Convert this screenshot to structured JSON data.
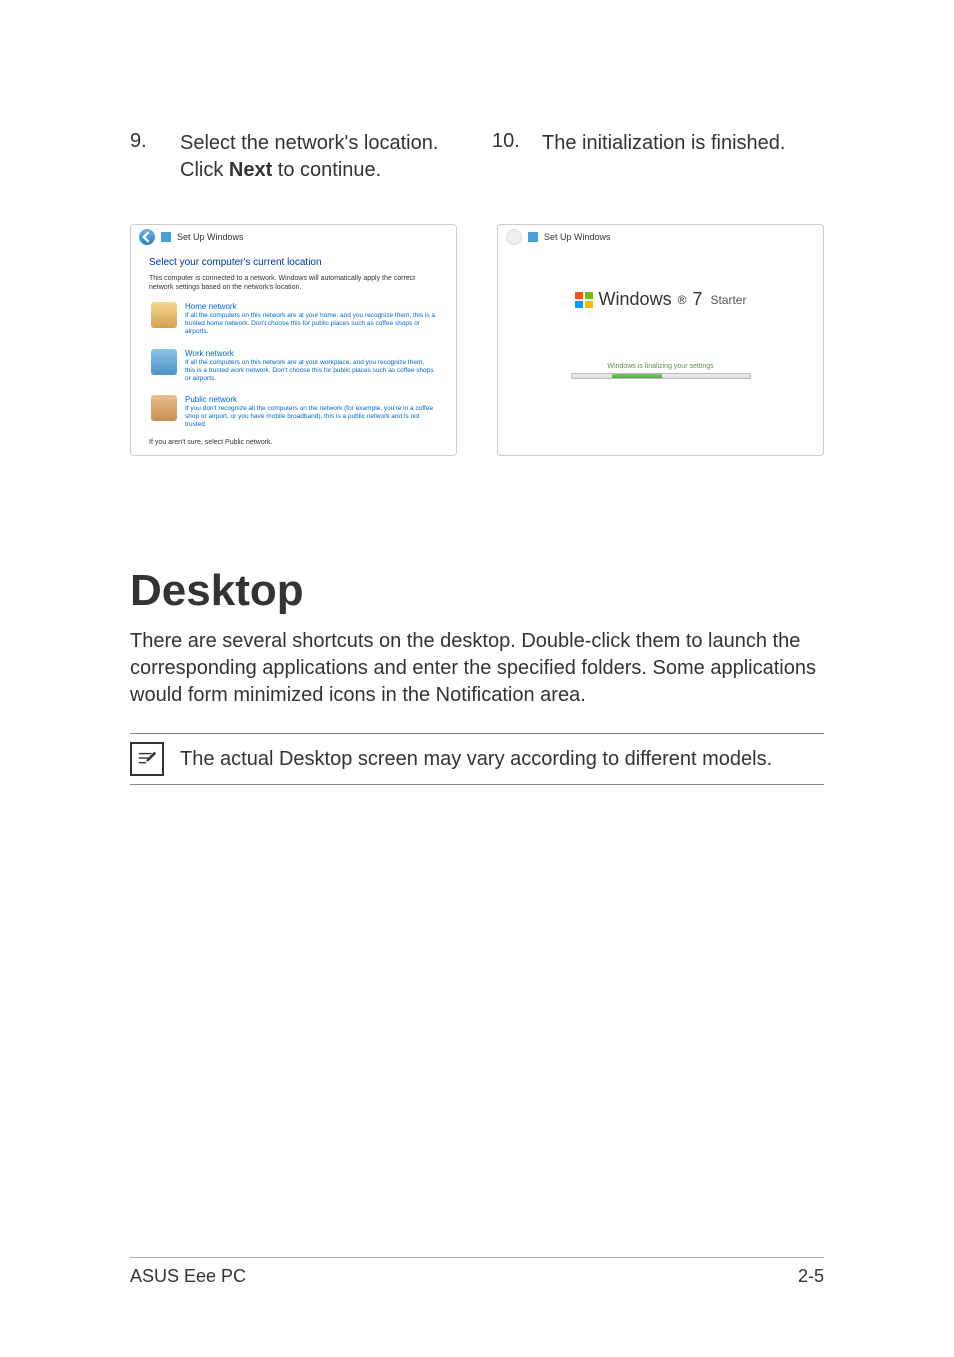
{
  "steps": {
    "nine": {
      "num": "9.",
      "text_a": "Select the network's location. Click ",
      "bold": "Next",
      "text_b": " to continue."
    },
    "ten": {
      "num": "10.",
      "text": "The initialization is finished."
    }
  },
  "shot1": {
    "window_title": "Set Up Windows",
    "title": "Select your computer's current location",
    "subtitle": "This computer is connected to a network. Windows will automatically apply the correct network settings based on the network's location.",
    "home": {
      "heading": "Home network",
      "desc": "If all the computers on this network are at your home, and you recognize them, this is a trusted home network. Don't choose this for public places such as coffee shops or airports."
    },
    "work": {
      "heading": "Work network",
      "desc": "If all the computers on this network are at your workplace, and you recognize them, this is a trusted work network. Don't choose this for public places such as coffee shops or airports."
    },
    "public": {
      "heading": "Public network",
      "desc": "If you don't recognize all the computers on the network (for example, you're in a coffee shop or airport, or you have mobile broadband), this is a public network and is not trusted."
    },
    "footer": "If you aren't sure, select Public network."
  },
  "shot2": {
    "window_title": "Set Up Windows",
    "brand_a": "Windows",
    "brand_b": "7",
    "brand_c": "Starter",
    "status": "Windows is finalizing your settings"
  },
  "section": {
    "heading": "Desktop",
    "body": "There are several shortcuts on the desktop. Double-click them to launch the corresponding applications and enter the specified folders. Some applications would form minimized icons in the Notification area.",
    "note": "The actual Desktop screen may vary according to different models."
  },
  "footer": {
    "left": "ASUS Eee PC",
    "right": "2-5"
  }
}
